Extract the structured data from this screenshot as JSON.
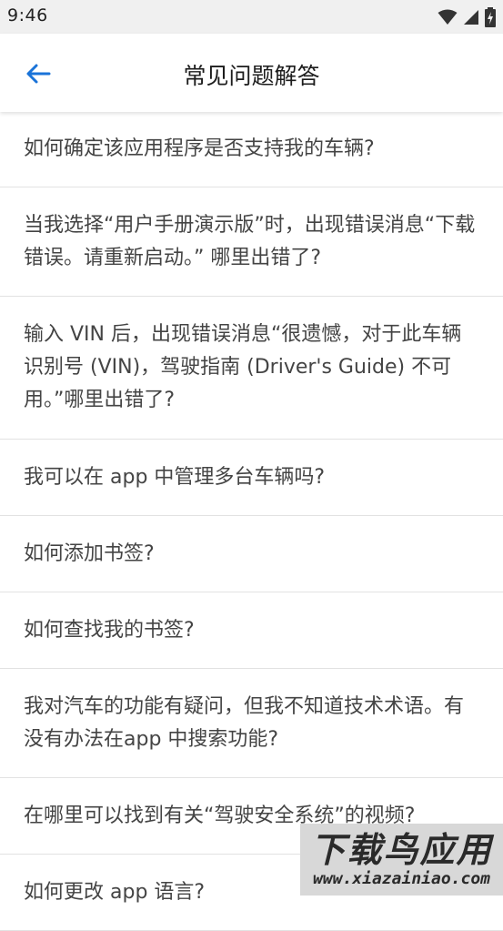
{
  "status_bar": {
    "time": "9:46",
    "icons": [
      "wifi-icon",
      "signal-icon",
      "battery-charging-icon"
    ]
  },
  "app_bar": {
    "back_icon": "arrow-left-icon",
    "title": "常见问题解答",
    "accent_color": "#1a73d8"
  },
  "faq": {
    "items": [
      {
        "question": "如何确定该应用程序是否支持我的车辆?"
      },
      {
        "question": "当我选择“用户手册演示版”时，出现错误消息“下载错误。请重新启动。” 哪里出错了?"
      },
      {
        "question": "输入 VIN 后，出现错误消息“很遗憾，对于此车辆识别号 (VIN)，驾驶指南 (Driver's Guide) 不可用。”哪里出错了?"
      },
      {
        "question": "我可以在 app 中管理多台车辆吗?"
      },
      {
        "question": "如何添加书签?"
      },
      {
        "question": "如何查找我的书签?"
      },
      {
        "question": "我对汽车的功能有疑问，但我不知道技术术语。有没有办法在app 中搜索功能?"
      },
      {
        "question": "在哪里可以找到有关“驾驶安全系统”的视频?"
      },
      {
        "question": "如何更改 app 语言?"
      }
    ]
  },
  "watermark": {
    "main": "下载鸟应用",
    "sub": "www.xiazainiao.com"
  }
}
